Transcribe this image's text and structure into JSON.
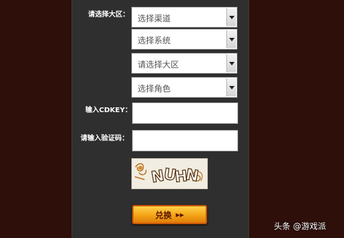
{
  "form": {
    "server_label": "请选择大区：",
    "channel_select": "选择渠道",
    "system_select": "选择系统",
    "zone_select": "请选择大区",
    "role_select": "选择角色",
    "cdkey_label": "输入CDKEY：",
    "cdkey_value": "",
    "captcha_label": "请输入验证码：",
    "captcha_value": "",
    "captcha_text": "NUHN",
    "submit_label": "兑换"
  },
  "watermark": "头条 @游戏派"
}
